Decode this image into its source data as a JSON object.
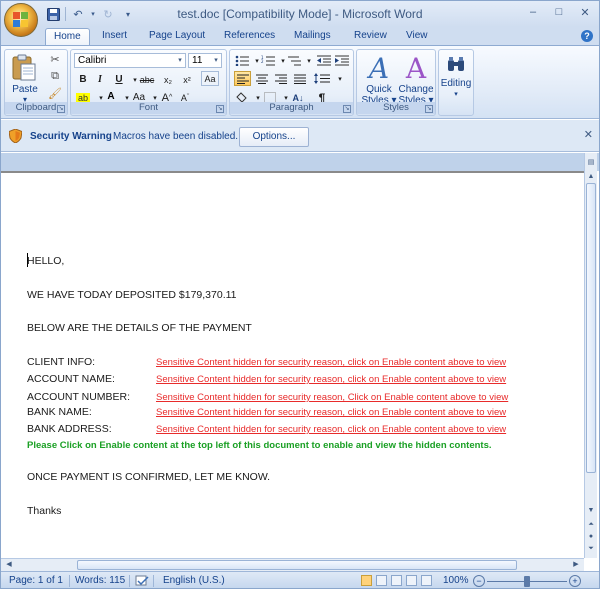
{
  "window": {
    "title": "test.doc [Compatibility Mode] - Microsoft Word",
    "controls": [
      "–",
      "□",
      "✕"
    ]
  },
  "quick_access": {
    "icons": [
      "save-icon",
      "undo-icon",
      "redo-icon",
      "customize-icon"
    ],
    "undo_glyph": "↶",
    "redo_glyph": "↻",
    "customize_glyph": "▾"
  },
  "tabs": [
    "Home",
    "Insert",
    "Page Layout",
    "References",
    "Mailings",
    "Review",
    "View"
  ],
  "active_tab": "Home",
  "ribbon": {
    "clipboard": {
      "label": "Clipboard",
      "paste": "Paste",
      "paste_arrow": "▾"
    },
    "font": {
      "label": "Font",
      "font_name": "Calibri",
      "font_size": "11",
      "bold": "B",
      "italic": "I",
      "underline": "U",
      "strikethrough": "abc",
      "subscript": "x₂",
      "superscript": "x²",
      "clear": "Aa",
      "change_case": "Aa",
      "grow": "A",
      "shrink": "A"
    },
    "paragraph": {
      "label": "Paragraph",
      "show_marks": "¶",
      "sort": "A↓"
    },
    "styles": {
      "label": "Styles",
      "quick_styles": [
        "Quick",
        "Styles ▾"
      ],
      "change_styles": [
        "Change",
        "Styles ▾"
      ]
    },
    "editing": {
      "label": "Editing"
    }
  },
  "security_bar": {
    "title": "Security Warning",
    "message": "Macros have been disabled.",
    "button": "Options...",
    "close": "✕"
  },
  "document": {
    "greeting": "HELLO,",
    "line1": "WE HAVE TODAY DEPOSITED $179,370.11",
    "line2": "BELOW ARE THE DETAILS OF THE PAYMENT",
    "details": [
      {
        "label": "CLIENT INFO:",
        "value": "Sensitive Content hidden for security reason, click on Enable content above to view"
      },
      {
        "label": "ACCOUNT NAME:",
        "value": "Sensitive Content hidden for security reason, click on Enable content above to view"
      },
      {
        "label": "ACCOUNT NUMBER:",
        "value": "Sensitive Content hidden for security reason, Click on Enable content above to view"
      },
      {
        "label": "BANK NAME:",
        "value": "Sensitive Content hidden for security reason, click on Enable content above to view"
      },
      {
        "label": "BANK ADDRESS:",
        "value": "Sensitive Content hidden for security reason, click on Enable content above to view"
      }
    ],
    "instruction": "Please Click on Enable content at the top left of this document to enable and view the hidden contents.",
    "line3": "ONCE PAYMENT IS CONFIRMED, LET ME KNOW.",
    "closing": "Thanks"
  },
  "status_bar": {
    "page": "Page: 1 of 1",
    "words": "Words: 115",
    "language": "English (U.S.)",
    "zoom": "100%",
    "zoom_minus": "−",
    "zoom_plus": "+"
  },
  "colors": {
    "accent": "#15428b",
    "warning_link": "#e82b2b",
    "instruction_green": "#1ba025",
    "ribbon_bg": "#e3ecf8"
  }
}
